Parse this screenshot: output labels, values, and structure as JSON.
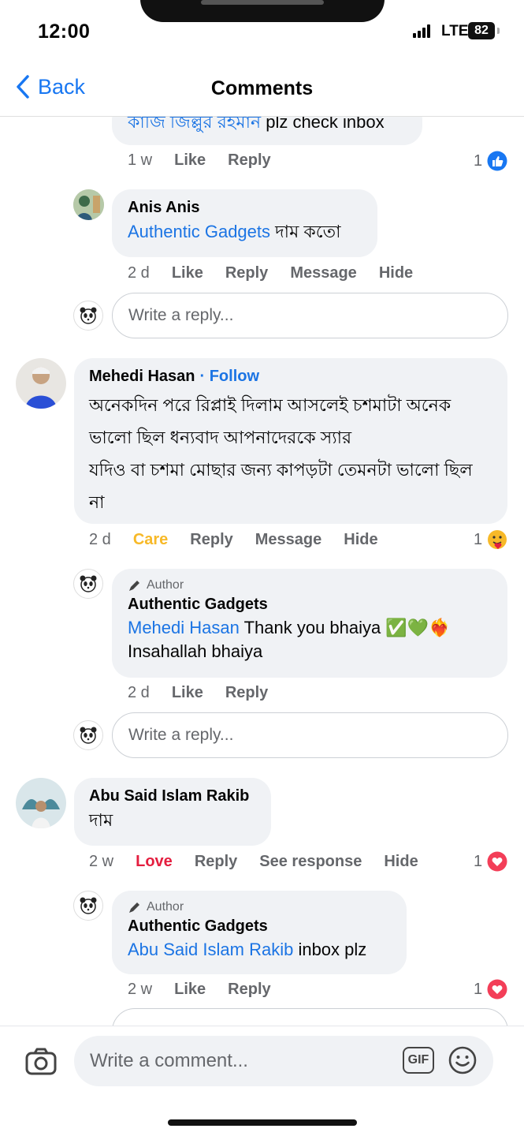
{
  "status_bar": {
    "time": "12:00",
    "network": "LTE",
    "battery": "82"
  },
  "nav": {
    "back_label": "Back",
    "title": "Comments"
  },
  "comments": [
    {
      "partial_text_prefix": "কাজি জিল্লুর রহমান",
      "partial_text_suffix": " plz check inbox",
      "time": "1 w",
      "like": "Like",
      "reply": "Reply",
      "reaction_count": "1"
    },
    {
      "name": "Anis Anis",
      "mention": "Authentic Gadgets",
      "text": " দাম কতো",
      "time": "2 d",
      "like": "Like",
      "reply": "Reply",
      "message": "Message",
      "hide": "Hide"
    },
    {
      "name": "Mehedi Hasan",
      "follow": "· Follow",
      "text_lines": [
        "অনেকদিন পরে রিপ্লাই দিলাম আসলেই চশমাটা অনেক",
        "ভালো ছিল ধন্যবাদ আপনাদেরকে স্যার",
        "যদিও বা চশমা মোছার জন্য কাপড়টা তেমনটা ভালো ছিল",
        "না"
      ],
      "time": "2 d",
      "reaction": "Care",
      "reply": "Reply",
      "message": "Message",
      "hide": "Hide",
      "reaction_count": "1"
    },
    {
      "author_tag": "Author",
      "name": "Authentic Gadgets",
      "mention": "Mehedi Hasan",
      "text": " Thank you bhaiya ✅💚❤️‍🔥",
      "text_line2": "Insahallah bhaiya",
      "time": "2 d",
      "like": "Like",
      "reply": "Reply"
    },
    {
      "name": "Abu Said Islam Rakib",
      "text": "দাম",
      "time": "2 w",
      "reaction": "Love",
      "reply": "Reply",
      "see_response": "See response",
      "hide": "Hide",
      "reaction_count": "1"
    },
    {
      "author_tag": "Author",
      "name": "Authentic Gadgets",
      "mention": "Abu Said Islam Rakib",
      "text": " inbox plz",
      "time": "2 w",
      "like": "Like",
      "reply": "Reply",
      "reaction_count": "1"
    }
  ],
  "reply_placeholder": "Write a reply...",
  "comment_placeholder": "Write a comment...",
  "gif_label": "GIF",
  "colors": {
    "accent": "#1b74e4",
    "care": "#f7b928",
    "love": "#e41e3f",
    "bubble": "#f0f2f5"
  }
}
